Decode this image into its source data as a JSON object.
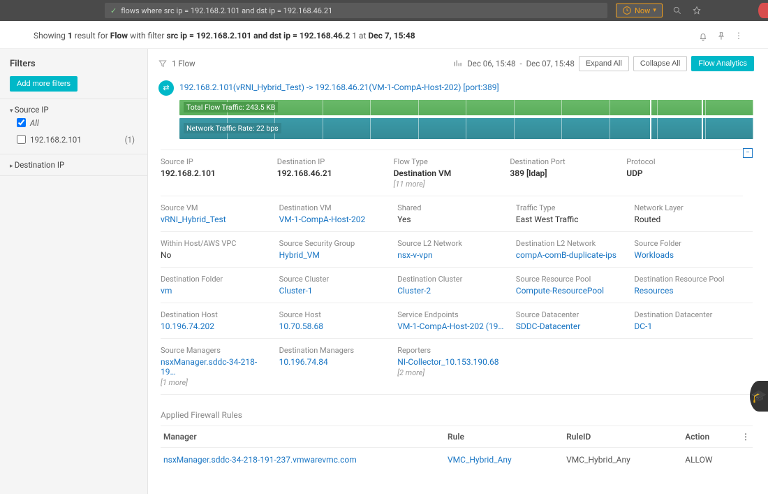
{
  "topbar": {
    "query": "flows where src ip = 192.168.2.101 and dst ip = 192.168.46.21",
    "time_label": "Now"
  },
  "summary": {
    "prefix": "Showing ",
    "count": "1",
    "mid1": " result for ",
    "entity": "Flow",
    "mid2": " with filter ",
    "filter": "src ip = 192.168.2.101 and dst ip = 192.168.46.2",
    "tail": "1 at ",
    "time": "Dec 7, 15:48"
  },
  "sidebar": {
    "title": "Filters",
    "add_label": "Add more filters",
    "groups": [
      {
        "name": "Source IP",
        "open": true,
        "items": [
          {
            "label": "All",
            "checked": true,
            "count": ""
          },
          {
            "label": "192.168.2.101",
            "checked": false,
            "count": "(1)"
          }
        ]
      },
      {
        "name": "Destination IP",
        "open": false,
        "items": []
      }
    ]
  },
  "content_head": {
    "flow_count": "1 Flow",
    "range_from": "Dec 06, 15:48",
    "range_sep": "-",
    "range_to": "Dec 07, 15:48",
    "expand": "Expand All",
    "collapse": "Collapse All",
    "analytics": "Flow Analytics"
  },
  "flow": {
    "title": "192.168.2.101(vRNI_Hybrid_Test) -> 192.168.46.21(VM-1-CompA-Host-202) [port:389]",
    "bar1_label": "Total Flow Traffic: 243.5 KB",
    "bar2_label": "Network Traffic Rate: 22 bps"
  },
  "rows": [
    [
      {
        "lbl": "Source IP",
        "val": "192.168.2.101",
        "link": false,
        "more": ""
      },
      {
        "lbl": "Destination IP",
        "val": "192.168.46.21",
        "link": false,
        "more": ""
      },
      {
        "lbl": "Flow Type",
        "val": "Destination VM",
        "link": false,
        "more": "[11 more]"
      },
      {
        "lbl": "Destination Port",
        "val": "389 [ldap]",
        "link": false,
        "more": ""
      },
      {
        "lbl": "Protocol",
        "val": "UDP",
        "link": false,
        "more": ""
      }
    ],
    [
      {
        "lbl": "Source VM",
        "val": "vRNI_Hybrid_Test",
        "link": true,
        "more": ""
      },
      {
        "lbl": "Destination VM",
        "val": "VM-1-CompA-Host-202",
        "link": true,
        "more": ""
      },
      {
        "lbl": "Shared",
        "val": "Yes",
        "link": false,
        "more": ""
      },
      {
        "lbl": "Traffic Type",
        "val": "East West Traffic",
        "link": false,
        "more": ""
      },
      {
        "lbl": "Network Layer",
        "val": "Routed",
        "link": false,
        "more": ""
      }
    ],
    [
      {
        "lbl": "Within Host/AWS VPC",
        "val": "No",
        "link": false,
        "more": ""
      },
      {
        "lbl": "Source Security Group",
        "val": "Hybrid_VM",
        "link": true,
        "more": ""
      },
      {
        "lbl": "Source L2 Network",
        "val": "nsx-v-vpn",
        "link": true,
        "more": ""
      },
      {
        "lbl": "Destination L2 Network",
        "val": "compA-comB-duplicate-ips",
        "link": true,
        "more": ""
      },
      {
        "lbl": "Source Folder",
        "val": "Workloads",
        "link": true,
        "more": ""
      }
    ],
    [
      {
        "lbl": "Destination Folder",
        "val": "vm",
        "link": true,
        "more": ""
      },
      {
        "lbl": "Source Cluster",
        "val": "Cluster-1",
        "link": true,
        "more": ""
      },
      {
        "lbl": "Destination Cluster",
        "val": "Cluster-2",
        "link": true,
        "more": ""
      },
      {
        "lbl": "Source Resource Pool",
        "val": "Compute-ResourcePool",
        "link": true,
        "more": ""
      },
      {
        "lbl": "Destination Resource Pool",
        "val": "Resources",
        "link": true,
        "more": ""
      }
    ],
    [
      {
        "lbl": "Destination Host",
        "val": "10.196.74.202",
        "link": true,
        "more": ""
      },
      {
        "lbl": "Source Host",
        "val": "10.70.58.68",
        "link": true,
        "more": ""
      },
      {
        "lbl": "Service Endpoints",
        "val": "VM-1-CompA-Host-202 (19…",
        "link": true,
        "more": ""
      },
      {
        "lbl": "Source Datacenter",
        "val": "SDDC-Datacenter",
        "link": true,
        "more": ""
      },
      {
        "lbl": "Destination Datacenter",
        "val": "DC-1",
        "link": true,
        "more": ""
      }
    ],
    [
      {
        "lbl": "Source Managers",
        "val": "nsxManager.sddc-34-218-19…",
        "link": true,
        "more": "[1 more]"
      },
      {
        "lbl": "Destination Managers",
        "val": "10.196.74.84",
        "link": true,
        "more": ""
      },
      {
        "lbl": "Reporters",
        "val": "NI-Collector_10.153.190.68",
        "link": true,
        "more": "[2 more]"
      },
      {
        "lbl": "",
        "val": "",
        "link": false,
        "more": ""
      },
      {
        "lbl": "",
        "val": "",
        "link": false,
        "more": ""
      }
    ]
  ],
  "rules": {
    "title": "Applied Firewall Rules",
    "headers": [
      "Manager",
      "Rule",
      "RuleID",
      "Action"
    ],
    "data": [
      {
        "manager": "nsxManager.sddc-34-218-191-237.vmwarevmc.com",
        "rule": "VMC_Hybrid_Any",
        "ruleid": "VMC_Hybrid_Any",
        "action": "ALLOW"
      }
    ]
  }
}
